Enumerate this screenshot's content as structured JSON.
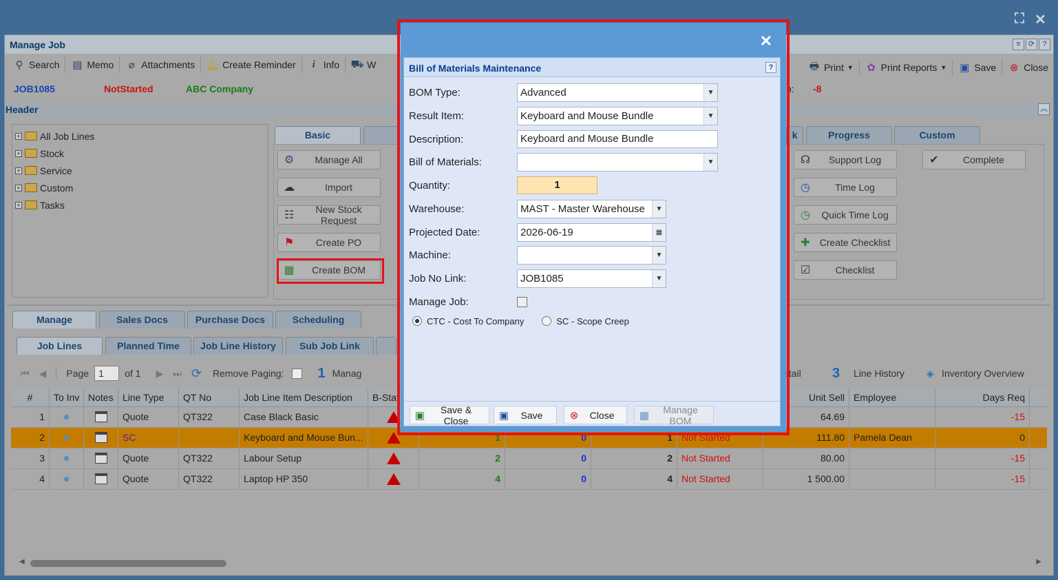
{
  "window": {
    "title": "Manage Job"
  },
  "toolbar": {
    "left": [
      {
        "label": "Search",
        "icon": "search-icon"
      },
      {
        "label": "Memo",
        "icon": "memo-icon"
      },
      {
        "label": "Attachments",
        "icon": "paperclip-icon"
      },
      {
        "label": "Create Reminder",
        "icon": "bell-icon"
      },
      {
        "label": "Info",
        "icon": "info-icon"
      },
      {
        "label": "W",
        "icon": "workflow-icon"
      }
    ],
    "right": [
      {
        "label": "Print",
        "icon": "print-icon"
      },
      {
        "label": "Print Reports",
        "icon": "print-reports-icon"
      },
      {
        "label": "Save",
        "icon": "save-icon"
      },
      {
        "label": "Close",
        "icon": "close-icon"
      }
    ]
  },
  "job": {
    "number": "JOB1085",
    "status": "NotStarted",
    "company": "ABC Company",
    "extra_label": "n:",
    "extra_value": "-8"
  },
  "header_section": {
    "title": "Header"
  },
  "tree": [
    "All Job Lines",
    "Stock",
    "Service",
    "Custom",
    "Tasks"
  ],
  "action_tabs": [
    "Basic",
    "k",
    "Progress",
    "Custom"
  ],
  "basic_actions": [
    "Manage All",
    "Import",
    "New Stock Request",
    "Create PO",
    "Create BOM"
  ],
  "progress_actions": [
    "Support Log",
    "Time Log",
    "Quick Time Log",
    "Create Checklist",
    "Checklist"
  ],
  "custom_actions": [
    "Complete"
  ],
  "bottom_tabs": [
    "Manage",
    "Sales Docs",
    "Purchase Docs",
    "Scheduling"
  ],
  "sub_tabs": [
    "Job Lines",
    "Planned Time",
    "Job Line History",
    "Sub Job Link"
  ],
  "pager": {
    "page_label": "Page",
    "page_value": "1",
    "of_label": "of 1",
    "remove_paging": "Remove Paging:",
    "num1": "1",
    "manage_label": "Manag",
    "detail_label": "etail",
    "num3": "3",
    "line_history": "Line History",
    "inventory_overview": "Inventory Overview"
  },
  "grid": {
    "headers": [
      "#",
      "To Inv",
      "Notes",
      "Line Type",
      "QT No",
      "Job Line Item Description",
      "B-Stat",
      "Unit Sell",
      "Employee",
      "Days Req"
    ],
    "rows": [
      {
        "n": "1",
        "type": "Quote",
        "qt": "QT322",
        "desc": "Case Black Basic",
        "c1": "",
        "c2": "",
        "c3": "",
        "status": "",
        "sell": "64.69",
        "emp": "",
        "days": "-15"
      },
      {
        "n": "2",
        "type": "SC",
        "qt": "",
        "desc": "Keyboard and Mouse Bun...",
        "c1": "1",
        "c2": "0",
        "c3": "1",
        "status": "Not Started",
        "sell": "111.80",
        "emp": "Pamela Dean",
        "days": "0"
      },
      {
        "n": "3",
        "type": "Quote",
        "qt": "QT322",
        "desc": "Labour Setup",
        "c1": "2",
        "c2": "0",
        "c3": "2",
        "status": "Not Started",
        "sell": "80.00",
        "emp": "",
        "days": "-15"
      },
      {
        "n": "4",
        "type": "Quote",
        "qt": "QT322",
        "desc": "Laptop HP 350",
        "c1": "4",
        "c2": "0",
        "c3": "4",
        "status": "Not Started",
        "sell": "1 500.00",
        "emp": "",
        "days": "-15"
      }
    ]
  },
  "modal": {
    "title": "Bill of Materials Maintenance",
    "help": "?",
    "fields": {
      "bom_type": {
        "label": "BOM Type:",
        "value": "Advanced"
      },
      "result_item": {
        "label": "Result Item:",
        "value": "Keyboard and Mouse Bundle"
      },
      "description": {
        "label": "Description:",
        "value": "Keyboard and Mouse Bundle"
      },
      "bom": {
        "label": "Bill of Materials:",
        "value": ""
      },
      "quantity": {
        "label": "Quantity:",
        "value": "1"
      },
      "warehouse": {
        "label": "Warehouse:",
        "value": "MAST - Master Warehouse"
      },
      "projected_date": {
        "label": "Projected Date:",
        "value": "2026-06-19"
      },
      "machine": {
        "label": "Machine:",
        "value": ""
      },
      "job_no_link": {
        "label": "Job No Link:",
        "value": "JOB1085"
      },
      "manage_job": {
        "label": "Manage Job:"
      }
    },
    "radio_ctc": "CTC - Cost To Company",
    "radio_sc": "SC - Scope Creep",
    "buttons": {
      "save_close": "Save & Close",
      "save": "Save",
      "close": "Close",
      "manage_bom": "Manage BOM"
    }
  },
  "colors": {
    "accent": "#5b9ad6",
    "highlight": "#e0141e",
    "selected_row": "#c47c00"
  }
}
